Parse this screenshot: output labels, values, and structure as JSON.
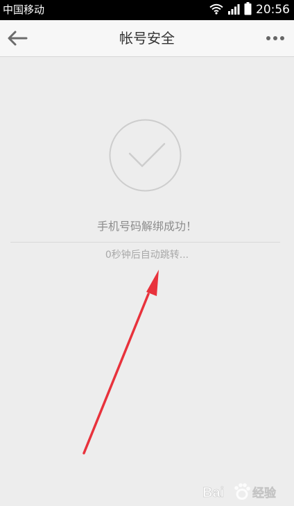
{
  "status_bar": {
    "carrier": "中国移动",
    "time": "20:56",
    "icons": [
      "wifi-icon",
      "signal-icon",
      "battery-icon"
    ]
  },
  "nav": {
    "back_icon": "arrow-left-icon",
    "title": "帐号安全",
    "more_icon": "more-dots-icon"
  },
  "content": {
    "success_icon": "checkmark-circle-icon",
    "message": "手机号码解绑成功！",
    "countdown": "0秒钟后自动跳转..."
  },
  "overlay": {
    "annotation": "red-arrow-icon",
    "watermark": "Bai经验",
    "arrow_color": "#e8323c"
  },
  "colors": {
    "status_bar": "#000000",
    "nav_bar": "#f7f7f7",
    "background": "#ededed",
    "text_primary": "#333333",
    "text_muted": "#8c8c8c"
  }
}
